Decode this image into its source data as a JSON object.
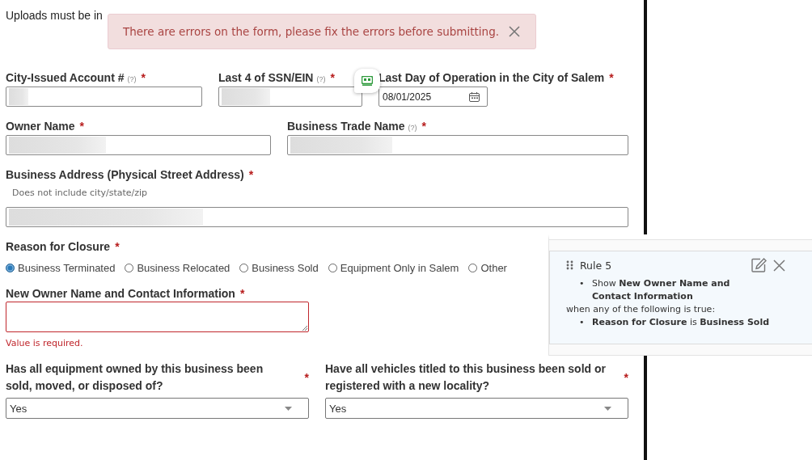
{
  "notice": "Uploads must be in",
  "alert": {
    "message": "There are errors on the form, please fix the errors before submitting."
  },
  "rows": [
    [
      {
        "kind": "text",
        "label": "City-Issued Account #",
        "help": "(?)",
        "required": "*",
        "redacted": true
      },
      {
        "kind": "text",
        "label": "Last 4 of SSN/EIN",
        "help": "(?)",
        "required": "*",
        "redacted": true
      },
      {
        "kind": "date",
        "label": "Last Day of Operation in the City of Salem",
        "required": "*",
        "value": "08/01/2025"
      }
    ],
    [
      {
        "kind": "text",
        "label": "Owner Name",
        "required": "*",
        "redacted": true
      },
      {
        "kind": "text",
        "label": "Business Trade Name",
        "help": "(?)",
        "required": "*",
        "redacted": true
      }
    ],
    [
      {
        "kind": "text",
        "label": "Business Address (Physical Street Address)",
        "required": "*",
        "hint": "Does not include city/state/zip",
        "redacted": true
      }
    ],
    [
      {
        "kind": "radio",
        "label": "Reason for Closure",
        "required": "*",
        "options": [
          {
            "label": "Business Terminated",
            "selected": true
          },
          {
            "label": "Business Relocated",
            "selected": false
          },
          {
            "label": "Business Sold",
            "selected": false
          },
          {
            "label": "Equipment Only in Salem",
            "selected": false
          },
          {
            "label": "Other",
            "selected": false
          }
        ]
      }
    ],
    [
      {
        "kind": "textarea",
        "label": "New Owner Name and Contact Information",
        "required": "*",
        "error": "Value is required."
      }
    ],
    [
      {
        "kind": "select",
        "label": "Has all equipment owned by this business been sold, moved, or disposed of?",
        "required": "*",
        "value": "Yes"
      },
      {
        "kind": "select",
        "label": "Have all vehicles titled to this business been sold or registered with a new locality?",
        "required": "*",
        "value": "Yes"
      }
    ]
  ],
  "rule": {
    "title": "Rule 5",
    "action": {
      "bullet": "•",
      "text": "Show **New Owner Name and Contact Information**"
    },
    "condition_intro": "when any of the following is true:",
    "condition": {
      "bullet": "•",
      "text": "**Reason for Closure** is **Business Sold**"
    }
  }
}
